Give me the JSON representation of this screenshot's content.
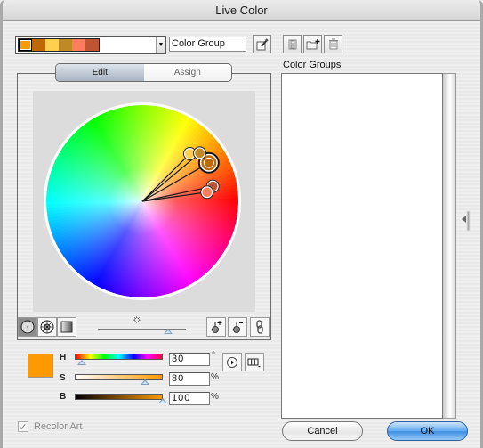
{
  "window": {
    "title": "Live Color"
  },
  "toolbar": {
    "color_group_swatches": [
      "#ff9900",
      "#bf6800",
      "#ffd04d",
      "#bf8a26",
      "#ff7d5c",
      "#bf5433"
    ],
    "group_name_value": "Color Group",
    "edit_group_icon": "eyedropper-edit-icon",
    "save_icon": "save-icon",
    "new_group_icon": "new-folder-icon",
    "delete_icon": "trash-icon"
  },
  "tabs": [
    {
      "label": "Edit",
      "active": true
    },
    {
      "label": "Assign",
      "active": false
    }
  ],
  "wheel": {
    "markers": [
      {
        "name": "base-color",
        "hue": 30,
        "saturation": 80,
        "color": "#bf6800",
        "base": true
      },
      {
        "name": "color-2",
        "hue": 45,
        "saturation": 70,
        "color": "#ffd04d"
      },
      {
        "name": "color-3",
        "hue": 40,
        "saturation": 78,
        "color": "#bf8a26"
      },
      {
        "name": "color-4",
        "hue": 12,
        "saturation": 75,
        "color": "#bf5433"
      },
      {
        "name": "color-5",
        "hue": 8,
        "saturation": 68,
        "color": "#ff7d5c"
      }
    ],
    "brightness_slider_value_pct": 80,
    "mode_buttons": [
      {
        "name": "smooth-wheel-icon",
        "active": true
      },
      {
        "name": "segmented-wheel-icon",
        "active": false
      },
      {
        "name": "color-bars-icon",
        "active": false
      }
    ],
    "action_buttons": [
      "add-color-icon",
      "remove-color-icon",
      "link-harmony-icon"
    ]
  },
  "hsb": {
    "preview_color": "#ff9900",
    "h": {
      "label": "H",
      "value": "30",
      "unit": "°",
      "fraction": 0.083
    },
    "s": {
      "label": "S",
      "value": "80",
      "unit": "%",
      "fraction": 0.8
    },
    "b": {
      "label": "B",
      "value": "100",
      "unit": "%",
      "fraction": 1.0
    }
  },
  "color_groups": {
    "label": "Color Groups",
    "items": []
  },
  "footer": {
    "recolor_art_label": "Recolor Art",
    "recolor_art_checked": true,
    "cancel_label": "Cancel",
    "ok_label": "OK"
  }
}
